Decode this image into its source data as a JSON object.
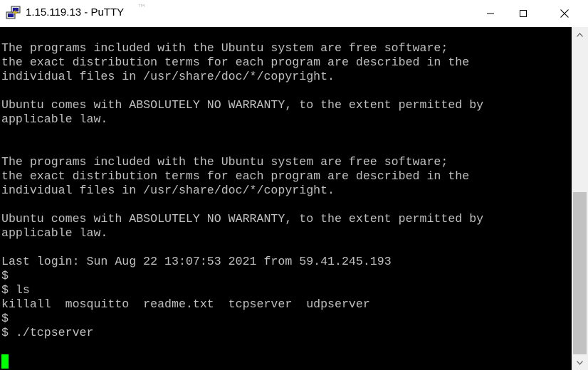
{
  "window": {
    "title": "1.15.119.13 - PuTTY",
    "trademark": "™",
    "icon": "putty-icon",
    "controls": {
      "minimize_icon": "minimize-icon",
      "maximize_icon": "maximize-icon",
      "close_icon": "close-icon"
    }
  },
  "terminal": {
    "lines": [
      "The programs included with the Ubuntu system are free software;",
      "the exact distribution terms for each program are described in the",
      "individual files in /usr/share/doc/*/copyright.",
      "",
      "Ubuntu comes with ABSOLUTELY NO WARRANTY, to the extent permitted by",
      "applicable law.",
      "",
      "",
      "The programs included with the Ubuntu system are free software;",
      "the exact distribution terms for each program are described in the",
      "individual files in /usr/share/doc/*/copyright.",
      "",
      "Ubuntu comes with ABSOLUTELY NO WARRANTY, to the extent permitted by",
      "applicable law.",
      "",
      "Last login: Sun Aug 22 13:07:53 2021 from 59.41.245.193",
      "$",
      "$ ls",
      "killall  mosquitto  readme.txt  tcpserver  udpserver",
      "$",
      "$ ./tcpserver",
      "",
      ""
    ],
    "text_color": "#c0c0c0",
    "background": "#000000",
    "cursor_color": "#00ff00"
  },
  "scrollbar": {
    "up_icon": "scroll-up-arrow-icon",
    "down_icon": "scroll-down-arrow-icon"
  }
}
